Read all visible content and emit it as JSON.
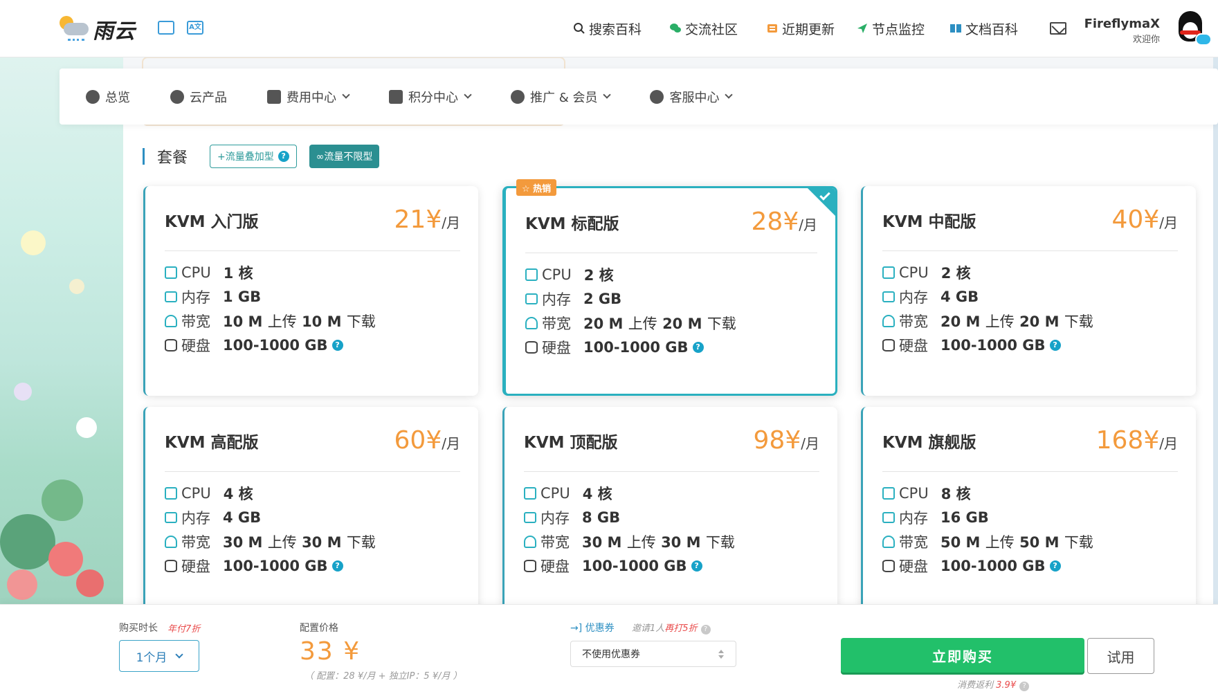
{
  "app": {
    "logo_text": "雨云",
    "top_icons": [
      "image-icon",
      "translate-icon"
    ],
    "translate_label": "A文"
  },
  "topnav": [
    {
      "label": "搜索百科",
      "icon": "search-icon"
    },
    {
      "label": "交流社区",
      "icon": "wechat-icon"
    },
    {
      "label": "近期更新",
      "icon": "news-icon"
    },
    {
      "label": "节点监控",
      "icon": "send-icon"
    },
    {
      "label": "文档百科",
      "icon": "book-icon"
    }
  ],
  "user": {
    "name": "FireflymaX",
    "greeting": "欢迎你"
  },
  "subnav": [
    {
      "label": "总览",
      "icon": "dashboard-icon",
      "dropdown": false
    },
    {
      "label": "云产品",
      "icon": "cubes-icon",
      "dropdown": false
    },
    {
      "label": "费用中心",
      "icon": "money-icon",
      "dropdown": true
    },
    {
      "label": "积分中心",
      "icon": "gift-icon",
      "dropdown": true
    },
    {
      "label": "推广 & 会员",
      "icon": "users-icon",
      "dropdown": true
    },
    {
      "label": "客服中心",
      "icon": "headset-icon",
      "dropdown": true
    }
  ],
  "section": {
    "title": "套餐",
    "filter_outline": "+流量叠加型",
    "filter_solid": "∞流量不限型",
    "help_mark": "?"
  },
  "plans": [
    {
      "name": "KVM 入门版",
      "price": "21",
      "currency": "¥",
      "per": "/月",
      "cpu": "1 核",
      "mem": "1 GB",
      "bw_up": "10 M",
      "bw_up_label": "上传",
      "bw_down": "10 M",
      "bw_down_label": "下载",
      "disk": "100-1000 GB",
      "hot": false,
      "selected": false
    },
    {
      "name": "KVM 标配版",
      "price": "28",
      "currency": "¥",
      "per": "/月",
      "cpu": "2 核",
      "mem": "2 GB",
      "bw_up": "20 M",
      "bw_up_label": "上传",
      "bw_down": "20 M",
      "bw_down_label": "下载",
      "disk": "100-1000 GB",
      "hot": true,
      "selected": true
    },
    {
      "name": "KVM 中配版",
      "price": "40",
      "currency": "¥",
      "per": "/月",
      "cpu": "2 核",
      "mem": "4 GB",
      "bw_up": "20 M",
      "bw_up_label": "上传",
      "bw_down": "20 M",
      "bw_down_label": "下载",
      "disk": "100-1000 GB",
      "hot": false,
      "selected": false
    },
    {
      "name": "KVM 高配版",
      "price": "60",
      "currency": "¥",
      "per": "/月",
      "cpu": "4 核",
      "mem": "4 GB",
      "bw_up": "30 M",
      "bw_up_label": "上传",
      "bw_down": "30 M",
      "bw_down_label": "下载",
      "disk": "100-1000 GB",
      "hot": false,
      "selected": false
    },
    {
      "name": "KVM 顶配版",
      "price": "98",
      "currency": "¥",
      "per": "/月",
      "cpu": "4 核",
      "mem": "8 GB",
      "bw_up": "30 M",
      "bw_up_label": "上传",
      "bw_down": "30 M",
      "bw_down_label": "下载",
      "disk": "100-1000 GB",
      "hot": false,
      "selected": false
    },
    {
      "name": "KVM 旗舰版",
      "price": "168",
      "currency": "¥",
      "per": "/月",
      "cpu": "8 核",
      "mem": "16 GB",
      "bw_up": "50 M",
      "bw_up_label": "上传",
      "bw_down": "50 M",
      "bw_down_label": "下载",
      "disk": "100-1000 GB",
      "hot": false,
      "selected": false
    }
  ],
  "spec_labels": {
    "cpu": "CPU",
    "mem": "内存",
    "bw": "带宽",
    "disk": "硬盘"
  },
  "hot_badge": "☆ 热销",
  "bottom": {
    "duration_label": "购买时长",
    "duration_note": "年付7折",
    "duration_value": "1个月",
    "price_label": "配置价格",
    "price_value": "33 ¥",
    "price_detail": "（ 配置：28 ¥/月 + 独立IP：5 ¥/月 ）",
    "coupon_label": "优惠券",
    "invite_prefix": "邀请1人",
    "invite_highlight": "再打5折",
    "coupon_value": "不使用优惠券",
    "buy_label": "立即购买",
    "trial_label": "试用",
    "cashback_prefix": "消费返利",
    "cashback_value": "3.9¥"
  },
  "colors": {
    "accent": "#2ab0bf",
    "price": "#f39a3c",
    "buy": "#22c06a",
    "link": "#2d8fc2"
  }
}
